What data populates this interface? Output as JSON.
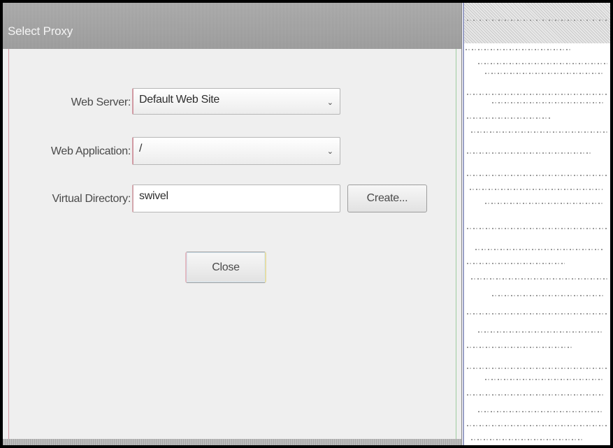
{
  "dialog": {
    "title": "Select Proxy",
    "web_server": {
      "label": "Web Server:",
      "value": "Default Web Site"
    },
    "web_application": {
      "label": "Web Application:",
      "value": "/"
    },
    "virtual_directory": {
      "label": "Virtual Directory:",
      "value": "swivel"
    },
    "create_button": "Create...",
    "close_button": "Close"
  },
  "icons": {
    "dropdown": "chevron-down-icon"
  },
  "colors": {
    "titlebar": "#a3a3a3",
    "client": "#efefef",
    "text": "#4a4a4a"
  }
}
